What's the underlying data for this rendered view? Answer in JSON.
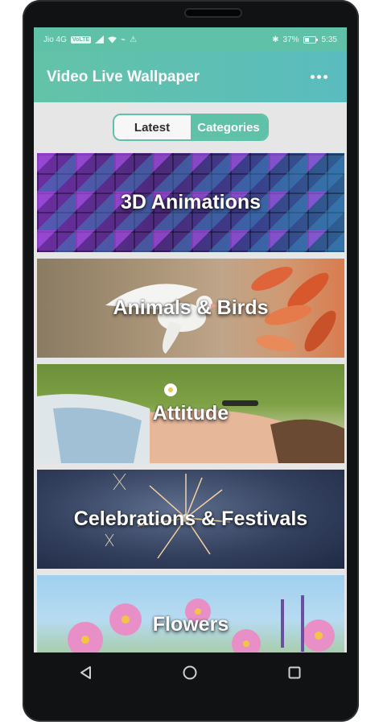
{
  "status_bar": {
    "carrier": "Jio 4G",
    "volte": "VoLTE",
    "battery": "37%",
    "time": "5:35"
  },
  "app_bar": {
    "title": "Video Live Wallpaper",
    "menu_icon": "more-vert-icon"
  },
  "tabs": [
    {
      "label": "Latest",
      "selected": false
    },
    {
      "label": "Categories",
      "selected": true
    }
  ],
  "categories": [
    {
      "label": "3D Animations"
    },
    {
      "label": "Animals & Birds"
    },
    {
      "label": "Attitude"
    },
    {
      "label": "Celebrations & Festivals"
    },
    {
      "label": "Flowers"
    }
  ],
  "colors": {
    "accent": "#5ec1a8",
    "screen_bg": "#e6e6e6",
    "phone_body": "#111214"
  },
  "nav_bar": {
    "back_icon": "back-icon",
    "home_icon": "home-icon",
    "recents_icon": "recents-icon"
  }
}
